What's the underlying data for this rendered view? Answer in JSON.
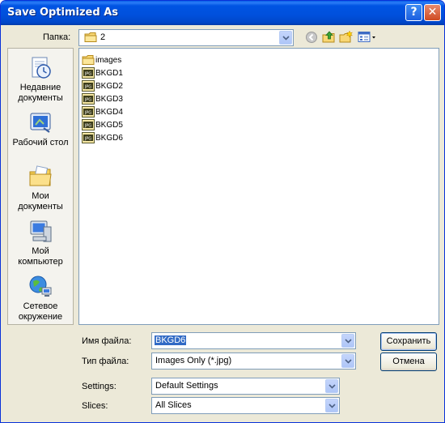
{
  "window": {
    "title": "Save Optimized As"
  },
  "titlebar_buttons": {
    "help": "?",
    "close": "✕"
  },
  "lookin": {
    "label": "Папка:",
    "value": "2"
  },
  "places": [
    {
      "label": "Недавние документы",
      "icon": "recent-documents-icon"
    },
    {
      "label": "Рабочий стол",
      "icon": "desktop-icon"
    },
    {
      "label": "Мои документы",
      "icon": "my-documents-icon"
    },
    {
      "label": "Мой компьютер",
      "icon": "my-computer-icon"
    },
    {
      "label": "Сетевое окружение",
      "icon": "network-places-icon"
    }
  ],
  "files": [
    {
      "name": "images",
      "type": "folder"
    },
    {
      "name": "BKGD1",
      "type": "jpg"
    },
    {
      "name": "BKGD2",
      "type": "jpg"
    },
    {
      "name": "BKGD3",
      "type": "jpg"
    },
    {
      "name": "BKGD4",
      "type": "jpg"
    },
    {
      "name": "BKGD5",
      "type": "jpg"
    },
    {
      "name": "BKGD6",
      "type": "jpg"
    }
  ],
  "form": {
    "filename_label": "Имя файла:",
    "filename_value": "BKGD6",
    "filetype_label": "Тип файла:",
    "filetype_value": "Images Only (*.jpg)",
    "settings_label": "Settings:",
    "settings_value": "Default Settings",
    "slices_label": "Slices:",
    "slices_value": "All Slices"
  },
  "buttons": {
    "save": "Сохранить",
    "cancel": "Отмена"
  },
  "colors": {
    "titlebar": "#0054e3",
    "dialog_bg": "#ece9d8",
    "selection": "#316ac5"
  }
}
